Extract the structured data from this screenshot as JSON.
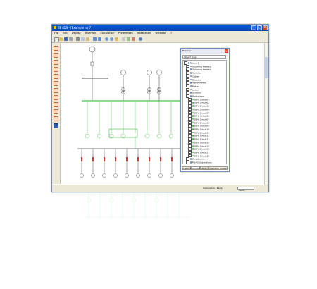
{
  "window": {
    "title": "EE LDS - [Example no 7]",
    "minimize": "_",
    "maximize": "□",
    "close": "x"
  },
  "menu": [
    "File",
    "Edit",
    "Display",
    "Insertion",
    "Calculation",
    "Preferences",
    "Installation",
    "Windows",
    "?"
  ],
  "toolbar_icons": [
    "new-icon",
    "open-icon",
    "save-icon",
    "print-icon",
    "cut-icon",
    "copy-icon",
    "paste-icon",
    "undo-icon",
    "redo-icon",
    "zoom-in-icon",
    "zoom-out-icon",
    "pan-icon",
    "grid-icon",
    "find-icon",
    "layers-icon",
    "help-icon"
  ],
  "palette_icons": [
    "source-icon",
    "transformer-icon",
    "generator-icon",
    "motor-icon",
    "breaker-icon",
    "switch-icon",
    "fuse-icon",
    "load-icon",
    "capacitor-icon",
    "busbar-icon",
    "cable-icon",
    "meter-icon"
  ],
  "status": {
    "message": "Calculation / Ready",
    "zoom": "100%"
  },
  "explorer": {
    "title": "Explorer",
    "search": "Object type",
    "close": "x",
    "tabs": [
      "Properties",
      "Structure",
      "Library",
      "Operation modes"
    ],
    "tree": [
      {
        "label": "Network",
        "level": 0
      },
      {
        "label": "Incoming feeders",
        "level": 1
      },
      {
        "label": "Outgoing feeders",
        "level": 1
      },
      {
        "label": "Switches",
        "level": 1
      },
      {
        "label": "Cables",
        "level": 1
      },
      {
        "label": "Busbars",
        "level": 1
      },
      {
        "label": "Transformers",
        "level": 1
      },
      {
        "label": "Motors",
        "level": 1
      },
      {
        "label": "Loads",
        "level": 1
      },
      {
        "label": "Sources",
        "level": 1
      },
      {
        "label": "Protections",
        "level": 1
      },
      {
        "label": "DEV. Circuit01",
        "level": 2
      },
      {
        "label": "DEV. Circuit02",
        "level": 2
      },
      {
        "label": "DEV. Circuit03",
        "level": 2
      },
      {
        "label": "DEV. Circuit04",
        "level": 2
      },
      {
        "label": "DEV. Circuit05",
        "level": 2
      },
      {
        "label": "DEV. Circuit06",
        "level": 2
      },
      {
        "label": "DEV. Circuit07",
        "level": 2
      },
      {
        "label": "DEV. Circuit08",
        "level": 2
      },
      {
        "label": "DEV. Circuit09",
        "level": 2
      },
      {
        "label": "DEV. Circuit10",
        "level": 2
      },
      {
        "label": "DEV. Circuit11",
        "level": 2
      },
      {
        "label": "DEV. Circuit12",
        "level": 2
      },
      {
        "label": "DEV. Circuit13",
        "level": 2
      },
      {
        "label": "DEV. Circuit14",
        "level": 2
      },
      {
        "label": "DEV. Circuit15",
        "level": 2
      },
      {
        "label": "DEV. Circuit16",
        "level": 2
      },
      {
        "label": "DEV. Circuit17",
        "level": 2
      },
      {
        "label": "DEV. Circuit18",
        "level": 2
      },
      {
        "label": "Distribution",
        "level": 1
      },
      {
        "label": "MV/LV Substations",
        "level": 1
      }
    ]
  },
  "colors": {
    "titlebar": "#0846b0",
    "chrome": "#ece9d8",
    "diagram_line": "#2f2f2f",
    "busbar_green": "#4ec24e",
    "load_red": "#d23c3c",
    "selection_green": "#1fa81f"
  }
}
